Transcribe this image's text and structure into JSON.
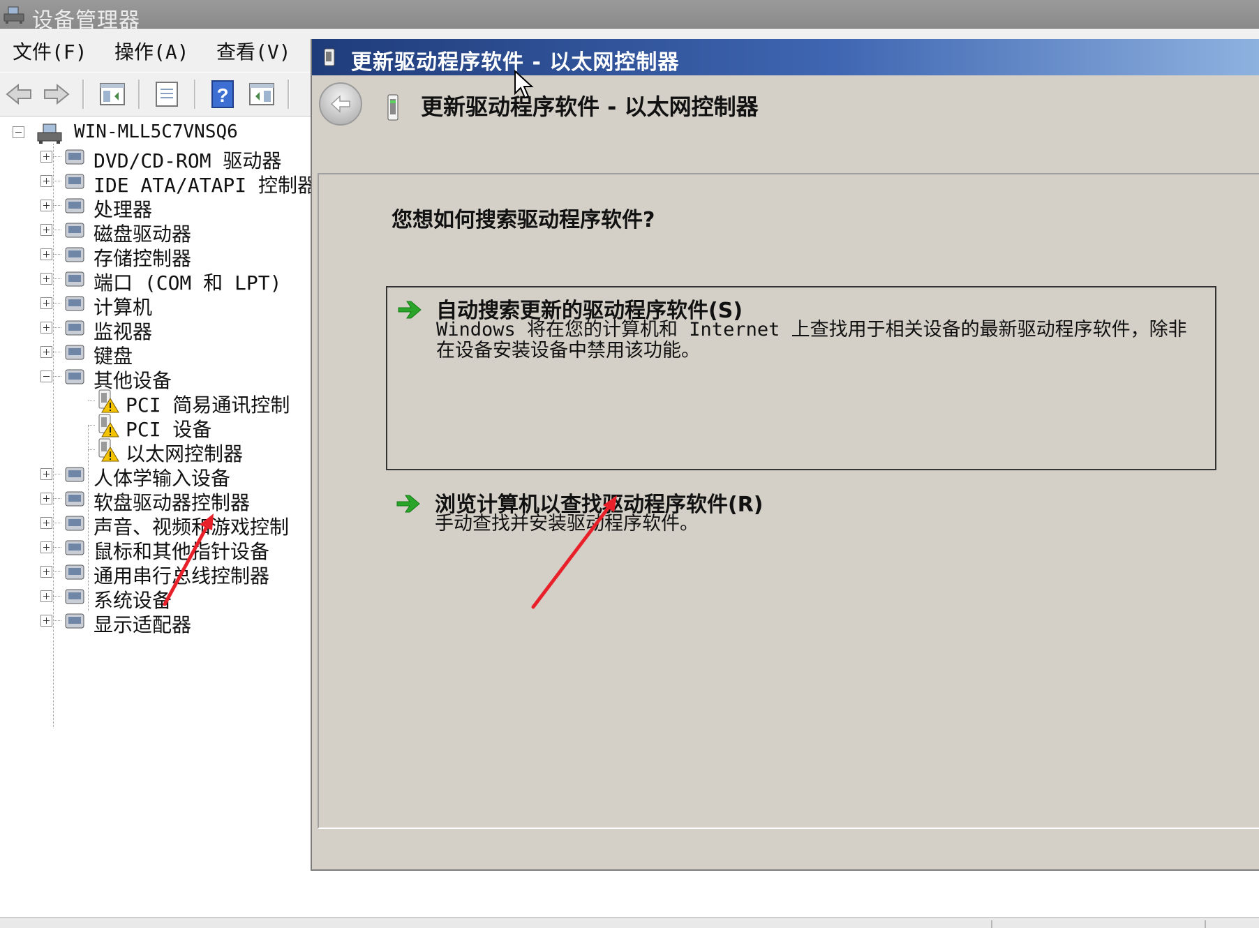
{
  "window": {
    "title": "设备管理器"
  },
  "menu": {
    "items": [
      "文件(F)",
      "操作(A)",
      "查看(V)"
    ]
  },
  "toolbar": {
    "buttons": [
      "back-arrow-icon",
      "forward-arrow-icon",
      "show-hide-tree-icon",
      "properties-icon",
      "help-icon",
      "action-pane-icon"
    ]
  },
  "tree": {
    "root": "WIN-MLL5C7VNSQ6",
    "items": [
      {
        "label": "DVD/CD-ROM 驱动器",
        "icon": "dvd-drive-icon",
        "expanded": false
      },
      {
        "label": "IDE ATA/ATAPI 控制器",
        "icon": "ide-controller-icon",
        "expanded": false
      },
      {
        "label": "处理器",
        "icon": "processor-icon",
        "expanded": false
      },
      {
        "label": "磁盘驱动器",
        "icon": "disk-drive-icon",
        "expanded": false
      },
      {
        "label": "存储控制器",
        "icon": "storage-controller-icon",
        "expanded": false
      },
      {
        "label": "端口 (COM 和 LPT)",
        "icon": "port-icon",
        "expanded": false
      },
      {
        "label": "计算机",
        "icon": "computer-icon",
        "expanded": false
      },
      {
        "label": "监视器",
        "icon": "monitor-icon",
        "expanded": false
      },
      {
        "label": "键盘",
        "icon": "keyboard-icon",
        "expanded": false
      },
      {
        "label": "其他设备",
        "icon": "other-devices-icon",
        "expanded": true
      }
    ],
    "children": [
      {
        "label": "PCI 简易通讯控制",
        "icon": "warning-device-icon"
      },
      {
        "label": "PCI 设备",
        "icon": "warning-device-icon"
      },
      {
        "label": "以太网控制器",
        "icon": "warning-device-icon"
      }
    ],
    "items_after": [
      {
        "label": "人体学输入设备",
        "icon": "hid-icon"
      },
      {
        "label": "软盘驱动器控制器",
        "icon": "floppy-controller-icon"
      },
      {
        "label": "声音、视频和游戏控制",
        "icon": "sound-icon"
      },
      {
        "label": "鼠标和其他指针设备",
        "icon": "mouse-icon"
      },
      {
        "label": "通用串行总线控制器",
        "icon": "usb-icon"
      },
      {
        "label": "系统设备",
        "icon": "system-devices-icon"
      },
      {
        "label": "显示适配器",
        "icon": "display-adapter-icon"
      }
    ]
  },
  "dialog": {
    "title": "更新驱动程序软件 - 以太网控制器",
    "header": "更新驱动程序软件 - 以太网控制器",
    "question": "您想如何搜索驱动程序软件?",
    "option1": {
      "title": "自动搜索更新的驱动程序软件(S)",
      "description": "Windows 将在您的计算机和 Internet 上查找用于相关设备的最新驱动程序软件，除非在设备安装设备中禁用该功能。"
    },
    "option2": {
      "title": "浏览计算机以查找驱动程序软件(R)",
      "description": "手动查找并安装驱动程序软件。"
    }
  },
  "colors": {
    "dialog_title_gradient_start": "#1f3c7a",
    "dialog_title_gradient_end": "#8fb3e0",
    "option_arrow": "#2aa52a",
    "annotation_arrow": "#e8202a"
  }
}
